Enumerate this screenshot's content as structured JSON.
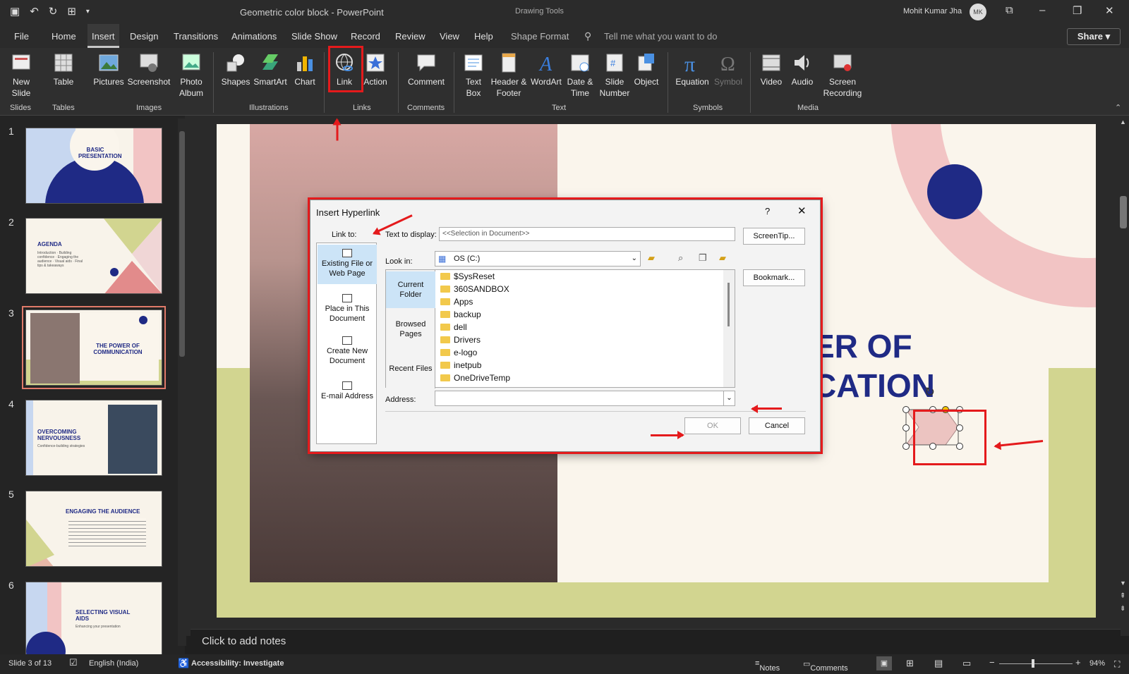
{
  "titlebar": {
    "qat_icons": [
      "save-icon",
      "undo-icon",
      "redo-icon",
      "touch-mode-icon"
    ],
    "doc_title": "Geometric color block  -  PowerPoint",
    "drawing_tools": "Drawing Tools",
    "user": "Mohit Kumar Jha",
    "avatar": "MK"
  },
  "menu": {
    "tabs": [
      "File",
      "Home",
      "Insert",
      "Design",
      "Transitions",
      "Animations",
      "Slide Show",
      "Record",
      "Review",
      "View",
      "Help",
      "Shape Format"
    ],
    "active": "Insert",
    "tell_me": "Tell me what you want to do",
    "share": "Share"
  },
  "ribbon": {
    "buttons": {
      "new_slide": "New Slide",
      "table": "Table",
      "pictures": "Pictures",
      "screenshot": "Screenshot",
      "photo_album": "Photo Album",
      "shapes": "Shapes",
      "smartart": "SmartArt",
      "chart": "Chart",
      "link": "Link",
      "action": "Action",
      "comment": "Comment",
      "text_box": "Text Box",
      "header_footer": "Header & Footer",
      "wordart": "WordArt",
      "date_time": "Date & Time",
      "slide_number": "Slide Number",
      "object": "Object",
      "equation": "Equation",
      "symbol": "Symbol",
      "video": "Video",
      "audio": "Audio",
      "screen_recording": "Screen Recording"
    },
    "groups": {
      "slides": "Slides",
      "tables": "Tables",
      "images": "Images",
      "illustrations": "Illustrations",
      "links": "Links",
      "comments": "Comments",
      "text": "Text",
      "symbols": "Symbols",
      "media": "Media"
    }
  },
  "slides": [
    {
      "num": "1",
      "title": "BASIC PRESENTATION",
      "sub": ""
    },
    {
      "num": "2",
      "title": "AGENDA",
      "sub": "Introduction · Building confidence · Engaging the audience · Visual aids · Final tips & takeaways"
    },
    {
      "num": "3",
      "title": "THE POWER OF COMMUNICATION",
      "sub": ""
    },
    {
      "num": "4",
      "title": "OVERCOMING NERVOUSNESS",
      "sub": "Confidence-building strategies"
    },
    {
      "num": "5",
      "title": "ENGAGING THE AUDIENCE",
      "sub": ""
    },
    {
      "num": "6",
      "title": "SELECTING VISUAL AIDS",
      "sub": "Enhancing your presentation"
    }
  ],
  "slide": {
    "title_line1": "ER OF",
    "title_line2": "CATION"
  },
  "notes": {
    "placeholder": "Click to add notes"
  },
  "status": {
    "slide": "Slide 3 of 13",
    "language": "English (India)",
    "accessibility": "Accessibility: Investigate",
    "notes": "Notes",
    "comments": "Comments",
    "zoom": "94%"
  },
  "dialog": {
    "title": "Insert Hyperlink",
    "help": "?",
    "link_to": "Link to:",
    "text_to_display_label": "Text to display:",
    "text_to_display_value": "<<Selection in Document>>",
    "screentip": "ScreenTip...",
    "nav": [
      "Existing File or Web Page",
      "Place in This Document",
      "Create New Document",
      "E-mail Address"
    ],
    "look_in_label": "Look in:",
    "look_in_value": "OS (C:)",
    "sub_nav": [
      "Current Folder",
      "Browsed Pages",
      "Recent Files"
    ],
    "folders": [
      "$SysReset",
      "360SANDBOX",
      "Apps",
      "backup",
      "dell",
      "Drivers",
      "e-logo",
      "inetpub",
      "OneDriveTemp"
    ],
    "bookmark": "Bookmark...",
    "address_label": "Address:",
    "ok": "OK",
    "cancel": "Cancel"
  },
  "colors": {
    "accent_red": "#e41a1c",
    "navy": "#1f2a85",
    "pink": "#f2c4c4",
    "olive": "#d2d590"
  }
}
